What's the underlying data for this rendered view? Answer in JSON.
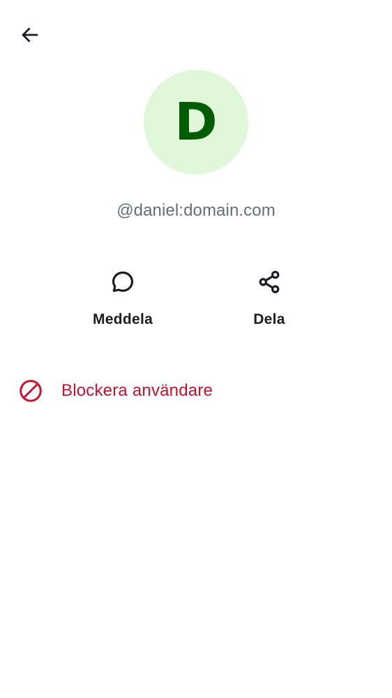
{
  "header": {
    "back_icon": "arrow-left-icon"
  },
  "profile": {
    "avatar_initial": "D",
    "user_id": "@daniel:domain.com",
    "avatar_bg_color": "#e0f8d9",
    "avatar_text_color": "#005c00"
  },
  "actions": [
    {
      "label": "Meddela",
      "icon": "chat-bubble-icon"
    },
    {
      "label": "Dela",
      "icon": "share-icon"
    }
  ],
  "block": {
    "label": "Blockera användare",
    "icon": "block-icon",
    "color": "#c9122d"
  }
}
